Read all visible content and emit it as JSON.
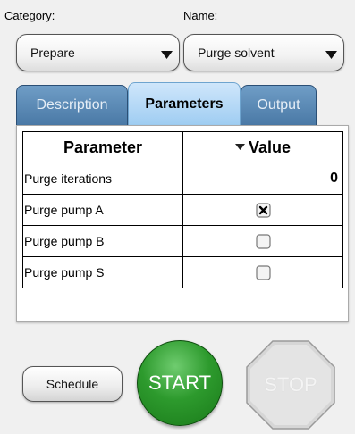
{
  "category": {
    "label": "Category:",
    "value": "Prepare"
  },
  "name": {
    "label": "Name:",
    "value": "Purge solvent"
  },
  "tabs": [
    {
      "label": "Description",
      "active": false
    },
    {
      "label": "Parameters",
      "active": true
    },
    {
      "label": "Output",
      "active": false
    }
  ],
  "grid": {
    "columns": [
      "Parameter",
      "Value"
    ],
    "rows": [
      {
        "name": "Purge iterations",
        "value": "0"
      },
      {
        "name": "Purge pump A",
        "checked": true
      },
      {
        "name": "Purge pump B",
        "checked": false
      },
      {
        "name": "Purge pump S",
        "checked": false
      }
    ]
  },
  "buttons": {
    "schedule": "Schedule",
    "start": "START",
    "stop": "STOP"
  },
  "colors": {
    "tab": "#4a79a6",
    "tab_active": "#9fcdf2",
    "start": "#2d9a2d",
    "stop": "#d6d6d6"
  }
}
